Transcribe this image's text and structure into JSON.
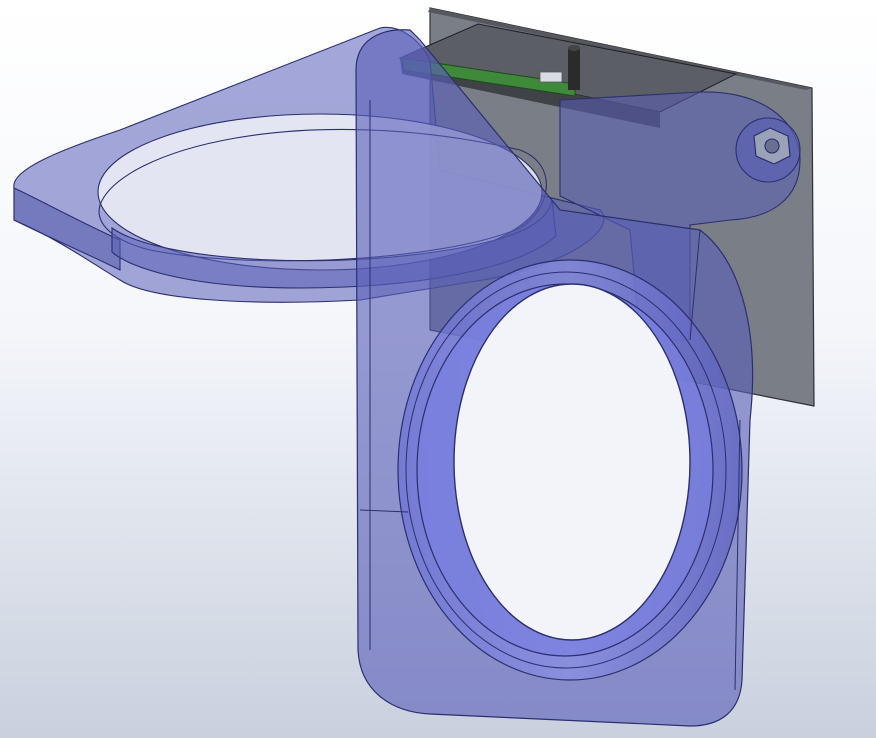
{
  "viewport": {
    "background_top": "#ffffff",
    "background_bottom": "#ccd3e0"
  },
  "model": {
    "bracket_fill": "#5a5fb8",
    "bracket_edge": "#2b2f6e",
    "board_fill": "#6f737c",
    "board_top": "#4f5258",
    "pcb_green": "#3f8a3a",
    "module_fill": "#5a5d63",
    "pin_color": "#2b2b2b",
    "nut_color": "#9aa2b8"
  }
}
